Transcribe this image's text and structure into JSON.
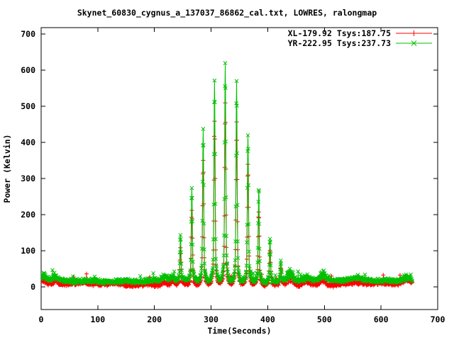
{
  "chart_data": {
    "type": "line",
    "title": "Skynet_60830_cygnus_a_137037_86862_cal.txt, LOWRES, ralongmap",
    "xlabel": "Time(Seconds)",
    "ylabel": "Power (Kelvin)",
    "xlim": [
      0,
      700
    ],
    "ylim": [
      -63,
      718
    ],
    "xticks": [
      0,
      100,
      200,
      300,
      400,
      500,
      600,
      700
    ],
    "yticks": [
      0,
      100,
      200,
      300,
      400,
      500,
      600,
      700
    ],
    "grid": false,
    "legend_position": "top-right-inside",
    "axis_color": "#000000",
    "data_time_range": [
      0,
      655
    ],
    "sample_step_seconds": 0.5,
    "peak_sigma_seconds": 1.0,
    "noise_seed": 1337,
    "series": [
      {
        "name": "XL-179.92 Tsys:187.75",
        "color": "#ff0000",
        "marker": "plus",
        "baseline_level": 7,
        "noise_amplitude": 11,
        "peaks": [
          [
            246,
            100
          ],
          [
            266,
            205
          ],
          [
            286,
            345
          ],
          [
            306,
            452
          ],
          [
            325,
            498
          ],
          [
            345,
            450
          ],
          [
            365,
            333
          ],
          [
            384,
            205
          ],
          [
            404,
            97
          ],
          [
            423,
            44
          ]
        ]
      },
      {
        "name": "YR-222.95 Tsys:237.73",
        "color": "#00c000",
        "marker": "cross",
        "baseline_level": 17,
        "noise_amplitude": 13,
        "peaks": [
          [
            246,
            125
          ],
          [
            266,
            252
          ],
          [
            286,
            420
          ],
          [
            306,
            552
          ],
          [
            325,
            601
          ],
          [
            345,
            549
          ],
          [
            365,
            406
          ],
          [
            384,
            251
          ],
          [
            404,
            119
          ],
          [
            423,
            56
          ]
        ]
      }
    ],
    "baseline_bumps": [
      [
        3,
        16,
        4
      ],
      [
        25,
        10,
        3
      ],
      [
        218,
        12,
        5
      ],
      [
        232,
        16,
        3
      ],
      [
        440,
        26,
        5
      ],
      [
        468,
        12,
        6
      ],
      [
        497,
        20,
        4
      ],
      [
        560,
        6,
        8
      ],
      [
        645,
        14,
        7
      ]
    ]
  }
}
